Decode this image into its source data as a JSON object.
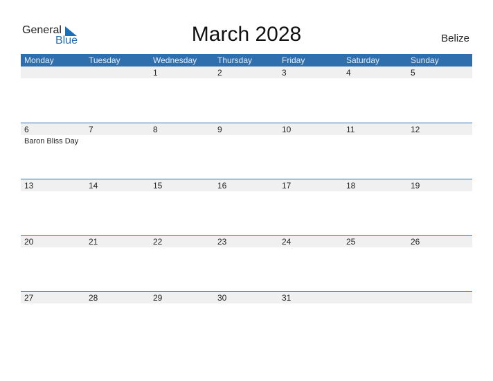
{
  "logo": {
    "general": "General",
    "blue": "Blue"
  },
  "title": "March 2028",
  "country": "Belize",
  "weekdays": [
    "Monday",
    "Tuesday",
    "Wednesday",
    "Thursday",
    "Friday",
    "Saturday",
    "Sunday"
  ],
  "weeks": [
    [
      "",
      "",
      "1",
      "2",
      "3",
      "4",
      "5"
    ],
    [
      "6",
      "7",
      "8",
      "9",
      "10",
      "11",
      "12"
    ],
    [
      "13",
      "14",
      "15",
      "16",
      "17",
      "18",
      "19"
    ],
    [
      "20",
      "21",
      "22",
      "23",
      "24",
      "25",
      "26"
    ],
    [
      "27",
      "28",
      "29",
      "30",
      "31",
      "",
      ""
    ]
  ],
  "holidays": {
    "w1d0": "Baron Bliss Day"
  }
}
